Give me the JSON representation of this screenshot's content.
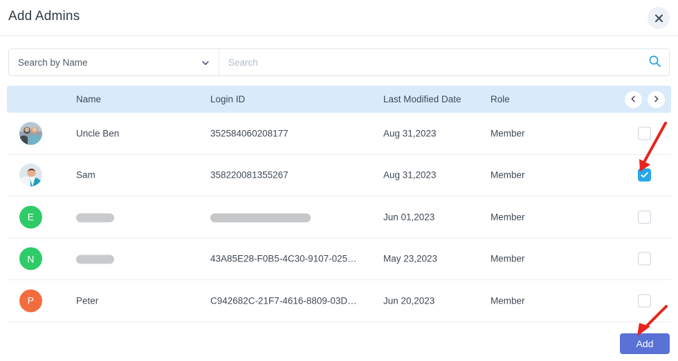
{
  "dialog": {
    "title": "Add Admins",
    "close_label": "close-icon",
    "accent_blue": "#27a7ea",
    "button_blue": "#5a71d6",
    "header_bg": "#d9ebfb",
    "annotation_red": "#e8231b"
  },
  "search": {
    "filter_selected": "Search by Name",
    "filter_options": [
      "Search by Name"
    ],
    "placeholder": "Search",
    "value": "",
    "icon": "search-icon",
    "chevron": "chevron-down-icon"
  },
  "table": {
    "columns": [
      "Name",
      "Login ID",
      "Last Modified Date",
      "Role"
    ],
    "pagination": {
      "prev": "chevron-left-icon",
      "next": "chevron-right-icon"
    },
    "rows": [
      {
        "avatar_type": "photo",
        "avatar_kind": "couple-photo",
        "avatar_initial": "",
        "avatar_color": "#e9edf1",
        "name": "Uncle Ben",
        "name_redacted": false,
        "login_id": "352584060208177",
        "login_redacted": false,
        "last_modified": "Aug 31,2023",
        "role": "Member",
        "checked": false
      },
      {
        "avatar_type": "photo",
        "avatar_kind": "man-photo",
        "avatar_initial": "",
        "avatar_color": "#e9edf1",
        "name": "Sam",
        "name_redacted": false,
        "login_id": "358220081355267",
        "login_redacted": false,
        "last_modified": "Aug 31,2023",
        "role": "Member",
        "checked": true
      },
      {
        "avatar_type": "initial",
        "avatar_kind": "letter-avatar",
        "avatar_initial": "E",
        "avatar_color": "#2ecb68",
        "name": "",
        "name_redacted": true,
        "login_id": "",
        "login_redacted": true,
        "last_modified": "Jun 01,2023",
        "role": "Member",
        "checked": false
      },
      {
        "avatar_type": "initial",
        "avatar_kind": "letter-avatar",
        "avatar_initial": "N",
        "avatar_color": "#2ecb68",
        "name": "",
        "name_redacted": true,
        "login_id": "43A85E28-F0B5-4C30-9107-025…",
        "login_redacted": false,
        "last_modified": "May 23,2023",
        "role": "Member",
        "checked": false
      },
      {
        "avatar_type": "initial",
        "avatar_kind": "letter-avatar",
        "avatar_initial": "P",
        "avatar_color": "#f26c3d",
        "name": "Peter",
        "name_redacted": false,
        "login_id": "C942682C-21F7-4616-8809-03D…",
        "login_redacted": false,
        "last_modified": "Jun 20,2023",
        "role": "Member",
        "checked": false
      }
    ]
  },
  "footer": {
    "add_label": "Add"
  }
}
